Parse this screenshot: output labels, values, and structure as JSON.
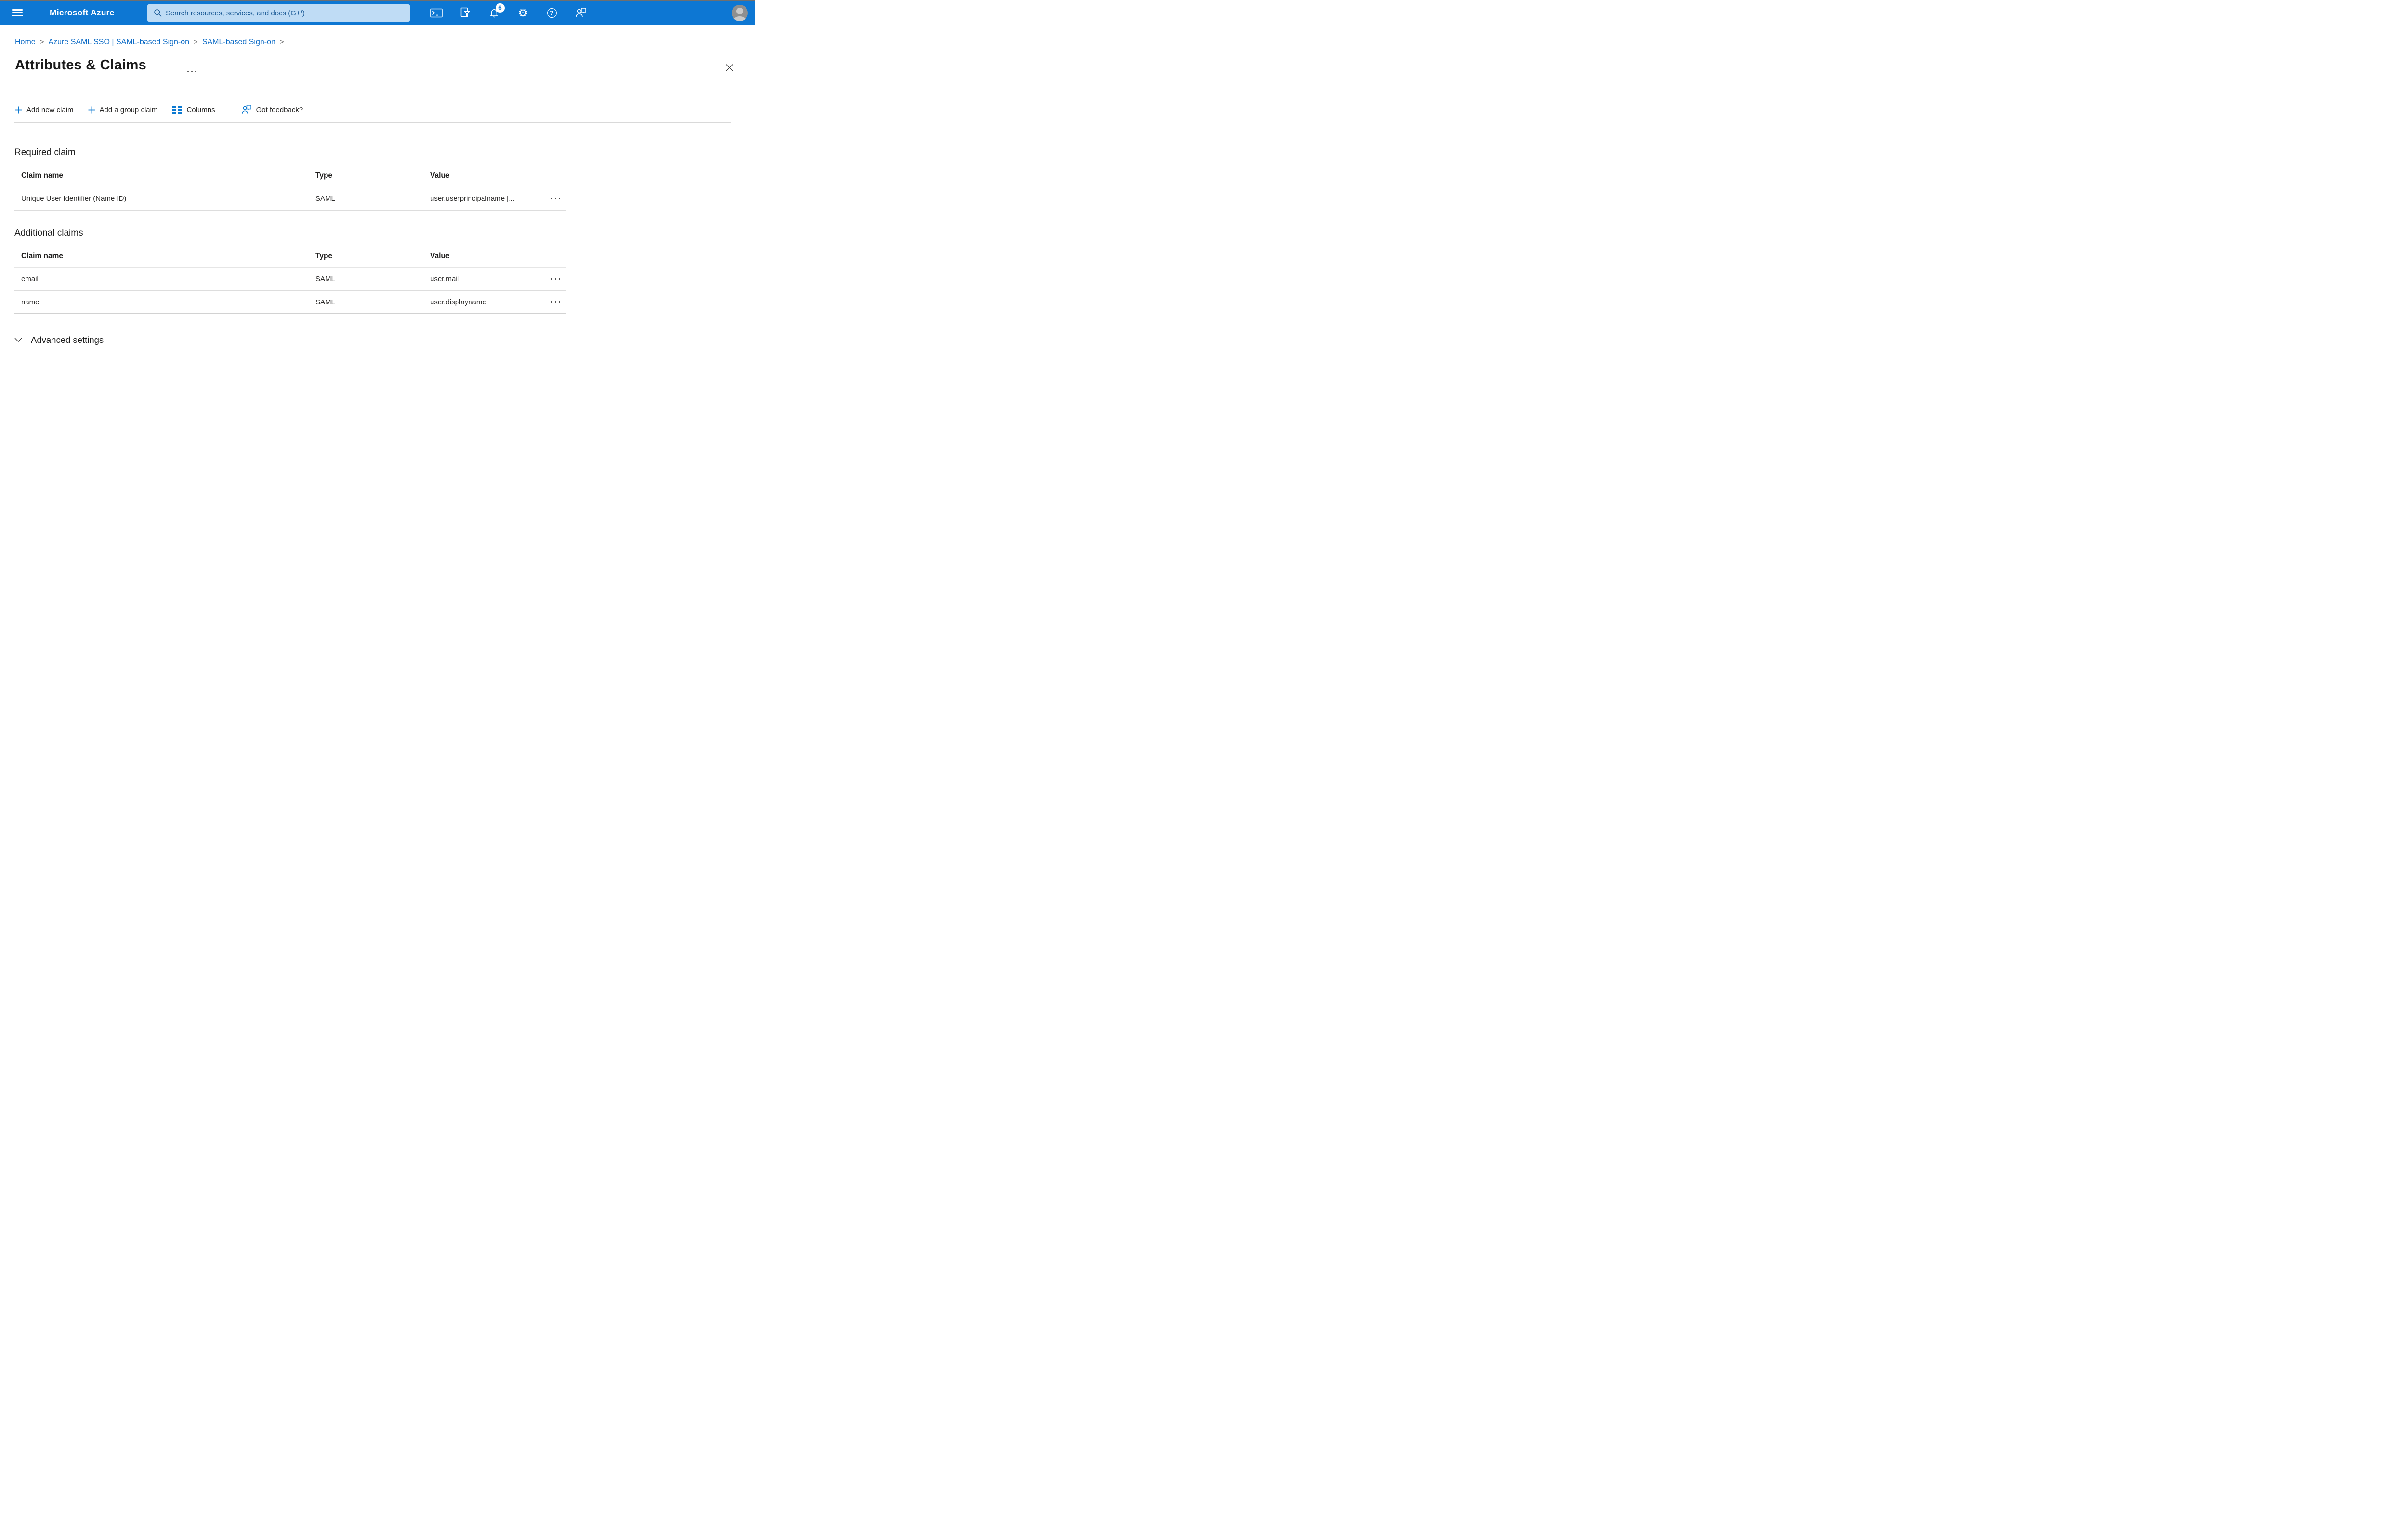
{
  "header": {
    "brand": "Microsoft Azure",
    "search": {
      "placeholder": "Search resources, services, and docs (G+/)"
    },
    "notifications_badge": "6",
    "help_glyph": "?",
    "gear_glyph": "⚙"
  },
  "breadcrumb": {
    "separator": ">",
    "items": [
      {
        "label": "Home"
      },
      {
        "label": "Azure SAML SSO | SAML-based Sign-on"
      },
      {
        "label": "SAML-based Sign-on"
      }
    ]
  },
  "page": {
    "title": "Attributes & Claims"
  },
  "toolbar": {
    "add_new_claim": "Add new claim",
    "add_group_claim": "Add a group claim",
    "columns": "Columns",
    "got_feedback": "Got feedback?"
  },
  "required_claim": {
    "heading": "Required claim",
    "columns": [
      "Claim name",
      "Type",
      "Value"
    ],
    "rows": [
      {
        "claim_name": "Unique User Identifier (Name ID)",
        "type": "SAML",
        "value": "user.userprincipalname [..."
      }
    ]
  },
  "additional_claims": {
    "heading": "Additional claims",
    "columns": [
      "Claim name",
      "Type",
      "Value"
    ],
    "rows": [
      {
        "claim_name": "email",
        "type": "SAML",
        "value": "user.mail"
      },
      {
        "claim_name": "name",
        "type": "SAML",
        "value": "user.displayname"
      }
    ]
  },
  "advanced": {
    "label": "Advanced settings"
  },
  "colors": {
    "topbar": "#0d77d3",
    "accent_icon": "#0b79d1",
    "link": "#0e6cc6",
    "search_bg": "#bfdcf5",
    "search_text": "#1a5a96"
  }
}
